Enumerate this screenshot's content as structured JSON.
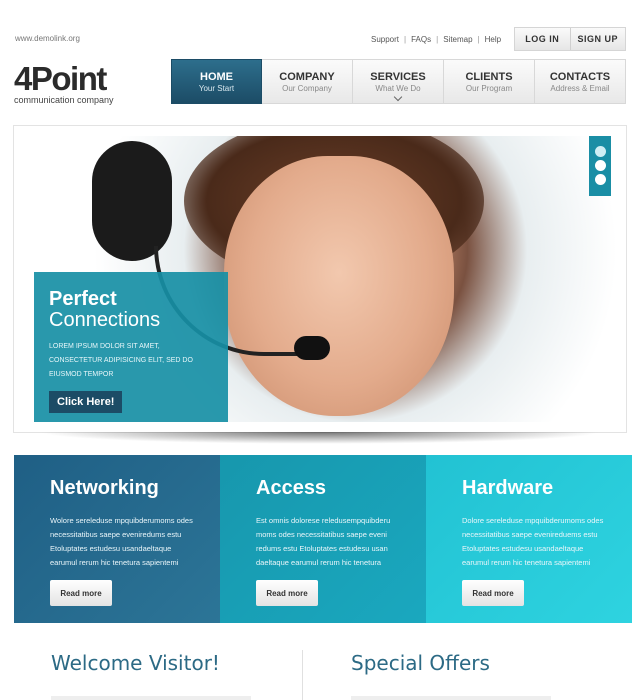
{
  "header": {
    "site_url": "www.demolink.org",
    "util_links": [
      "Support",
      "FAQs",
      "Sitemap",
      "Help"
    ],
    "auth": {
      "login": "LOG IN",
      "signup": "SIGN UP"
    }
  },
  "logo": {
    "name": "4Point",
    "tagline": "communication company"
  },
  "nav": {
    "items": [
      {
        "title": "HOME",
        "sub": "Your Start",
        "active": true
      },
      {
        "title": "COMPANY",
        "sub": "Our Company"
      },
      {
        "title": "SERVICES",
        "sub": "What We Do",
        "has_dropdown": true
      },
      {
        "title": "CLIENTS",
        "sub": "Our Program"
      },
      {
        "title": "CONTACTS",
        "sub": "Address & Email"
      }
    ]
  },
  "slider": {
    "title_line1": "Perfect",
    "title_line2": "Connections",
    "text": "Lorem ipsum dolor sit amet, consectetur adipisicing elit, sed do eiusmod tempor",
    "button": "Click Here!",
    "pager_count": 3
  },
  "features": [
    {
      "title": "Networking",
      "text": "Wolore sereleduse mpquibderumoms odes necessitatibus saepe eveniredums estu Etoluptates estudesu usandaeltaque earumul rerum hic tenetura sapientemi",
      "button": "Read more"
    },
    {
      "title": "Access",
      "text": "Est omnis dolorese reledusempquibderu moms odes necessitatibus saepe eveni redums estu Etoluptates estudesu usan daeltaque earumul rerum hic tenetura",
      "button": "Read more"
    },
    {
      "title": "Hardware",
      "text": "Dolore sereleduse mpquibderumoms odes necessitatibus saepe evenireduems estu Etoluptates estudesu usandaeltaque earumul rerum hic tenetura sapientemi",
      "button": "Read more"
    }
  ],
  "sections": {
    "welcome": "Welcome Visitor!",
    "offers": "Special Offers"
  },
  "colors": {
    "nav_active": "#1c4c66",
    "teal": "#1797ad",
    "light_teal": "#2ed3e0",
    "heading": "#2c6a85"
  }
}
